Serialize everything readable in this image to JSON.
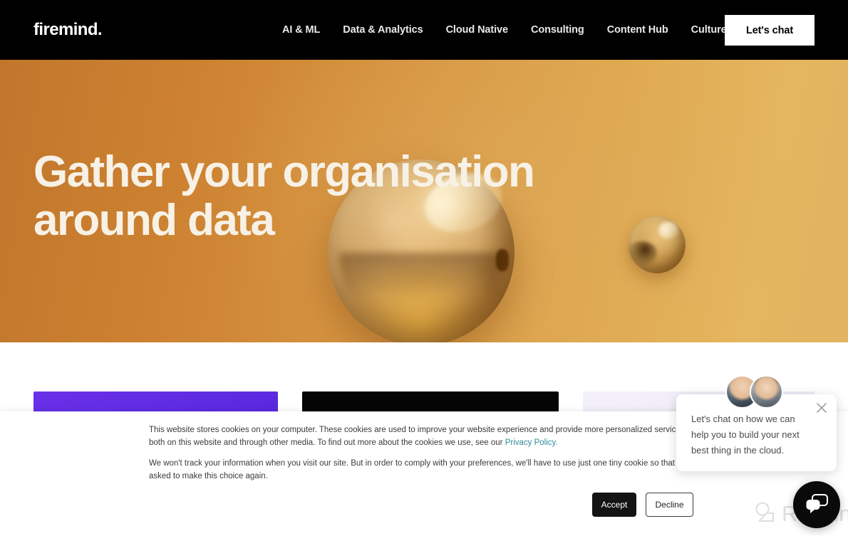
{
  "header": {
    "logo": "firemind.",
    "nav": [
      {
        "label": "AI & ML"
      },
      {
        "label": "Data & Analytics"
      },
      {
        "label": "Cloud Native"
      },
      {
        "label": "Consulting"
      },
      {
        "label": "Content Hub"
      },
      {
        "label": "Culture"
      }
    ],
    "cta_label": "Let's chat",
    "background_color": "#000000"
  },
  "hero": {
    "heading_line_1": "Gather your organisation",
    "heading_line_2": "around data",
    "heading_color": "#f7f1e6",
    "gradient_from": "#c1762c",
    "gradient_to": "#e2b360"
  },
  "cards": [
    {
      "name": "card-purple",
      "color": "#5c2ae0"
    },
    {
      "name": "card-black",
      "color": "#050505"
    },
    {
      "name": "card-lavender",
      "color": "#f1ecf7"
    }
  ],
  "cookie_banner": {
    "paragraph_1_a": "This website stores cookies on your computer. These cookies are used to improve your website experience and provide more personalized services to you, both on this website and through other media. To find out more about the cookies we use, see our ",
    "privacy_link": "Privacy Policy.",
    "paragraph_2": "We won't track your information when you visit our site. But in order to comply with your preferences, we'll have to use just one tiny cookie so that you're not asked to make this choice again.",
    "accept_label": "Accept",
    "decline_label": "Decline",
    "link_color": "#2e8b99"
  },
  "chat_widget": {
    "message": "Let's chat on how we can help you to build your next best thing in the cloud.",
    "close_icon": "close-icon",
    "bubble_icon": "chat-bubble-icon",
    "avatar_count": 2
  },
  "watermark": {
    "text": "Revain",
    "color": "#dedede"
  }
}
